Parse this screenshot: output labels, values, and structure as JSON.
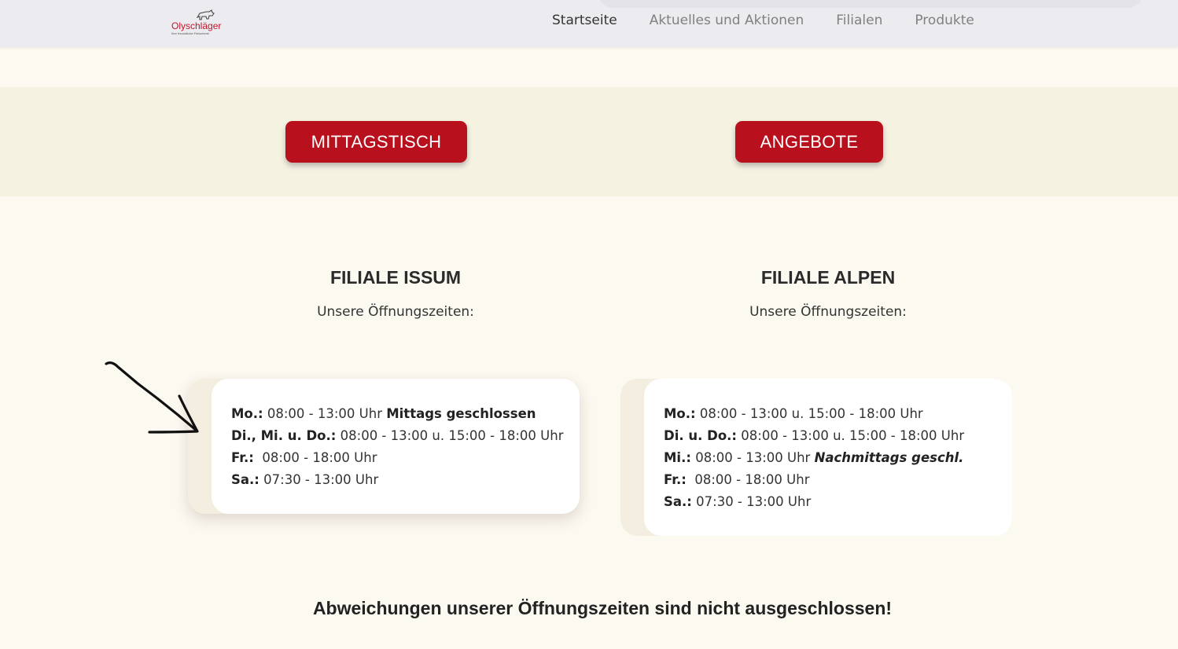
{
  "logo": {
    "name": "Olyschläger",
    "tagline": "Ihre freundliche Fleischerei"
  },
  "nav": {
    "items": [
      {
        "label": "Startseite"
      },
      {
        "label": "Aktuelles und Aktionen"
      },
      {
        "label": "Filialen"
      },
      {
        "label": "Produkte"
      }
    ]
  },
  "buttons": {
    "mittagstisch": "MITTAGSTISCH",
    "angebote": "ANGEBOTE"
  },
  "issum": {
    "title": "FILIALE ISSUM",
    "subtitle": "Unsere Öffnungszeiten:",
    "rows": [
      {
        "day": "Mo.:",
        "time": " 08:00 - 13:00 Uhr ",
        "note": "Mittags geschlossen"
      },
      {
        "day": "Di., Mi. u. Do.:",
        "time": " 08:00 - 13:00 u. 15:00 - 18:00 Uhr"
      },
      {
        "day": "Fr.:",
        "time": "  08:00 - 18:00 Uhr"
      },
      {
        "day": "Sa.:",
        "time": " 07:30 - 13:00 Uhr"
      }
    ]
  },
  "alpen": {
    "title": "FILIALE ALPEN",
    "subtitle": "Unsere Öffnungszeiten:",
    "rows": [
      {
        "day": "Mo.:",
        "time": " 08:00 - 13:00 u. 15:00 - 18:00 Uhr"
      },
      {
        "day": "Di. u. Do.:",
        "time": " 08:00 - 13:00 u. 15:00 - 18:00 Uhr"
      },
      {
        "day": "Mi.:",
        "time": " 08:00 - 13:00 Uhr ",
        "note": "Nachmittags geschl."
      },
      {
        "day": "Fr.:",
        "time": "  08:00 - 18:00 Uhr"
      },
      {
        "day": "Sa.:",
        "time": " 07:30 - 13:00 Uhr"
      }
    ]
  },
  "notice": "Abweichungen unserer Öffnungszeiten sind nicht ausgeschlossen!",
  "colors": {
    "brand_red": "#b8101c",
    "header_bg": "#ebebf0",
    "page_bg": "#fcf9f1",
    "band_bg": "#f6f2e2"
  }
}
